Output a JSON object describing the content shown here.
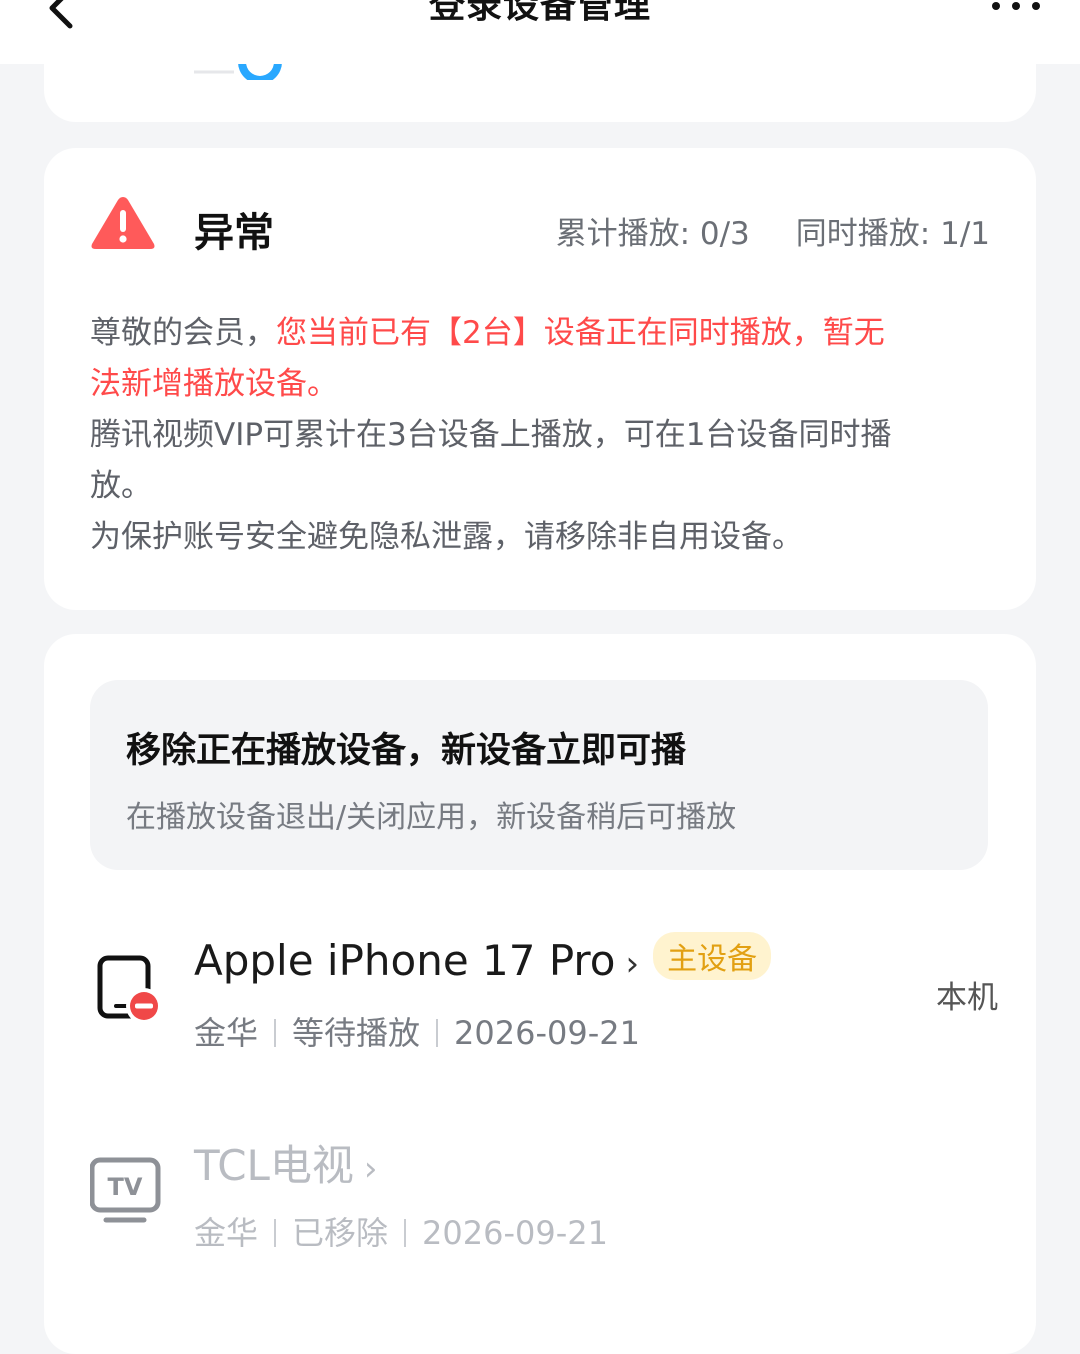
{
  "header": {
    "title": "登录设备管理"
  },
  "warning": {
    "title": "异常",
    "total_play": "累计播放: 0/3",
    "concurrent_play": "同时播放: 1/1",
    "greeting": "尊敬的会员，",
    "alert_line1": "您当前已有【2台】设备正在同时播放，暂无",
    "alert_line2": "法新增播放设备。",
    "info_line1": "腾讯视频VIP可累计在3台设备上播放，可在1台设备同时播",
    "info_line2": "放。",
    "info_line3": "为保护账号安全避免隐私泄露，请移除非自用设备。",
    "colors": {
      "alert": "#ff4a4a",
      "icon": "#ff5a5a"
    }
  },
  "tip": {
    "title": "移除正在播放设备，新设备立即可播",
    "subtitle": "在播放设备退出/关闭应用，新设备稍后可播放"
  },
  "devices": [
    {
      "name": "Apple iPhone 17 Pro",
      "chevron": "›",
      "badge": "主设备",
      "location": "金华",
      "status": "等待播放",
      "date": "2026-09-21",
      "right_label": "本机",
      "icon": "tablet-remove-icon"
    },
    {
      "name": "TCL电视",
      "chevron": "›",
      "location": "金华",
      "status": "已移除",
      "date": "2026-09-21",
      "icon": "tv-icon",
      "icon_text": "TV"
    }
  ]
}
